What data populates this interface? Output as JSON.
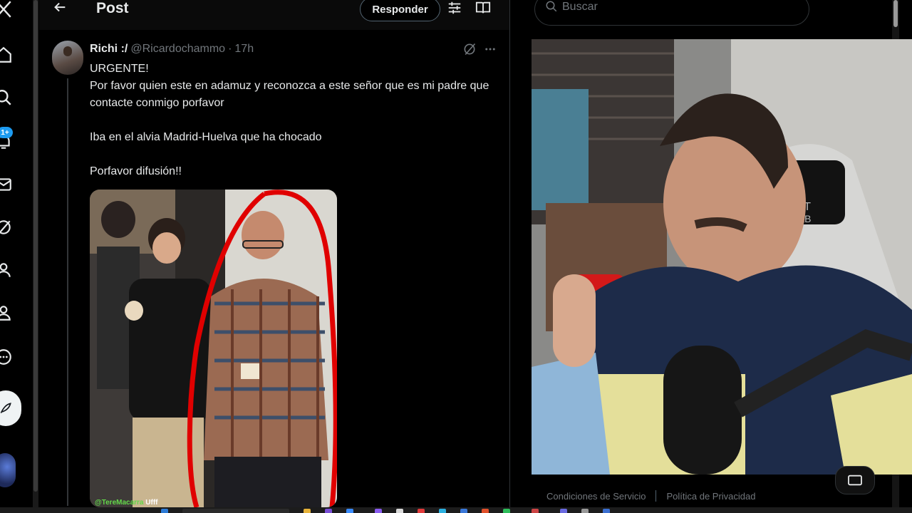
{
  "nav": {
    "badge_count": "1+",
    "icons": [
      "x-logo-icon",
      "home-icon",
      "explore-icon",
      "notifications-icon",
      "messages-icon",
      "grok-icon",
      "communities-icon",
      "profile-icon",
      "more-icon",
      "post-compose-icon"
    ]
  },
  "header": {
    "title": "Post",
    "reply_label": "Responder"
  },
  "tweet": {
    "name": "Richi :/",
    "handle": "@Ricardochammo",
    "dot": "·",
    "time": "17h",
    "lines": [
      "URGENTE!",
      "Por favor quien este en adamuz y reconozca a este señor que es mi padre que contacte conmigo porfavor",
      "Iba en el alvia Madrid-Huelva que ha chocado",
      "Porfavor difusión!!"
    ]
  },
  "search": {
    "placeholder": "Buscar"
  },
  "footer": {
    "terms": "Condiciones de Servicio",
    "privacy": "Política de Privacidad"
  },
  "overlay": {
    "chat_user": "@TereMacarra",
    "chat_message": "Ufff",
    "chair_text_1": "RET",
    "chair_text_2": "LAB"
  },
  "colors": {
    "accent": "#1d9bf0",
    "background": "#000000",
    "text_primary": "#e7e9ea",
    "text_secondary": "#71767b",
    "highlight_circle": "#e00000"
  }
}
